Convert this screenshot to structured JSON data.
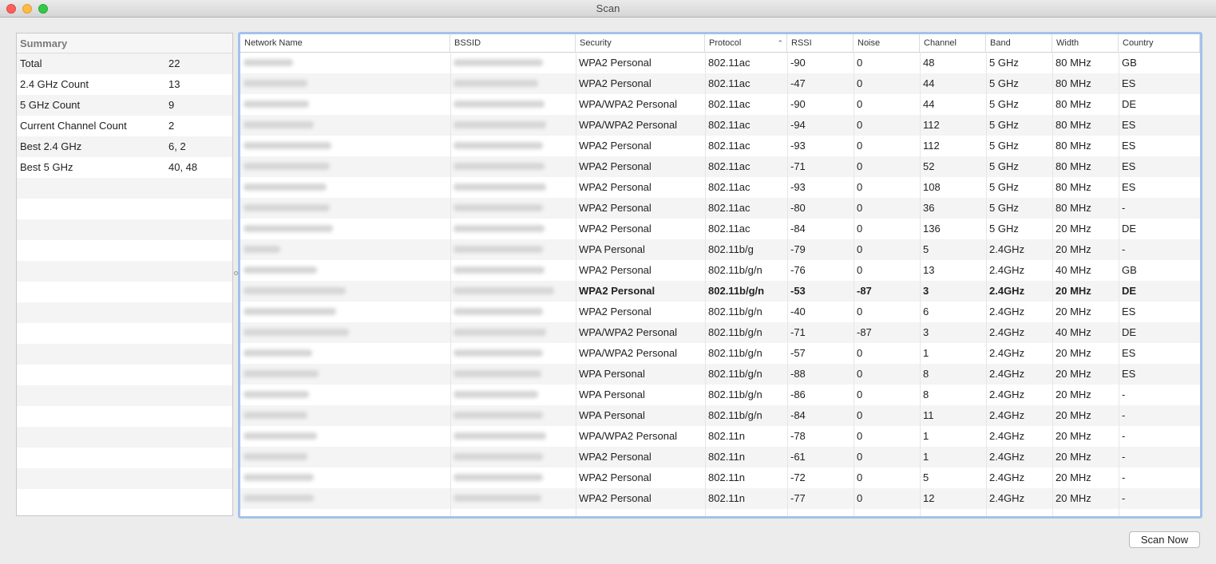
{
  "window": {
    "title": "Scan"
  },
  "summary": {
    "header": "Summary",
    "rows": [
      {
        "label": "Total",
        "value": "22"
      },
      {
        "label": "2.4 GHz Count",
        "value": "13"
      },
      {
        "label": "5 GHz Count",
        "value": "9"
      },
      {
        "label": "Current Channel Count",
        "value": "2"
      },
      {
        "label": "Best 2.4 GHz",
        "value": "6, 2"
      },
      {
        "label": "Best 5 GHz",
        "value": "40, 48"
      }
    ]
  },
  "table": {
    "columns": [
      "Network Name",
      "BSSID",
      "Security",
      "Protocol",
      "RSSI",
      "Noise",
      "Channel",
      "Band",
      "Width",
      "Country"
    ],
    "sorted_column": "Protocol",
    "rows": [
      {
        "security": "WPA2 Personal",
        "protocol": "802.11ac",
        "rssi": "-90",
        "noise": "0",
        "channel": "48",
        "band": "5 GHz",
        "width": "80 MHz",
        "country": "GB"
      },
      {
        "security": "WPA2 Personal",
        "protocol": "802.11ac",
        "rssi": "-47",
        "noise": "0",
        "channel": "44",
        "band": "5 GHz",
        "width": "80 MHz",
        "country": "ES"
      },
      {
        "security": "WPA/WPA2 Personal",
        "protocol": "802.11ac",
        "rssi": "-90",
        "noise": "0",
        "channel": "44",
        "band": "5 GHz",
        "width": "80 MHz",
        "country": "DE"
      },
      {
        "security": "WPA/WPA2 Personal",
        "protocol": "802.11ac",
        "rssi": "-94",
        "noise": "0",
        "channel": "112",
        "band": "5 GHz",
        "width": "80 MHz",
        "country": "ES"
      },
      {
        "security": "WPA2 Personal",
        "protocol": "802.11ac",
        "rssi": "-93",
        "noise": "0",
        "channel": "112",
        "band": "5 GHz",
        "width": "80 MHz",
        "country": "ES"
      },
      {
        "security": "WPA2 Personal",
        "protocol": "802.11ac",
        "rssi": "-71",
        "noise": "0",
        "channel": "52",
        "band": "5 GHz",
        "width": "80 MHz",
        "country": "ES"
      },
      {
        "security": "WPA2 Personal",
        "protocol": "802.11ac",
        "rssi": "-93",
        "noise": "0",
        "channel": "108",
        "band": "5 GHz",
        "width": "80 MHz",
        "country": "ES"
      },
      {
        "security": "WPA2 Personal",
        "protocol": "802.11ac",
        "rssi": "-80",
        "noise": "0",
        "channel": "36",
        "band": "5 GHz",
        "width": "80 MHz",
        "country": "-"
      },
      {
        "security": "WPA2 Personal",
        "protocol": "802.11ac",
        "rssi": "-84",
        "noise": "0",
        "channel": "136",
        "band": "5 GHz",
        "width": "20 MHz",
        "country": "DE"
      },
      {
        "security": "WPA Personal",
        "protocol": "802.11b/g",
        "rssi": "-79",
        "noise": "0",
        "channel": "5",
        "band": "2.4GHz",
        "width": "20 MHz",
        "country": "-"
      },
      {
        "security": "WPA2 Personal",
        "protocol": "802.11b/g/n",
        "rssi": "-76",
        "noise": "0",
        "channel": "13",
        "band": "2.4GHz",
        "width": "40 MHz",
        "country": "GB"
      },
      {
        "security": "WPA2 Personal",
        "protocol": "802.11b/g/n",
        "rssi": "-53",
        "noise": "-87",
        "channel": "3",
        "band": "2.4GHz",
        "width": "20 MHz",
        "country": "DE",
        "current": true
      },
      {
        "security": "WPA2 Personal",
        "protocol": "802.11b/g/n",
        "rssi": "-40",
        "noise": "0",
        "channel": "6",
        "band": "2.4GHz",
        "width": "20 MHz",
        "country": "ES"
      },
      {
        "security": "WPA/WPA2 Personal",
        "protocol": "802.11b/g/n",
        "rssi": "-71",
        "noise": "-87",
        "channel": "3",
        "band": "2.4GHz",
        "width": "40 MHz",
        "country": "DE"
      },
      {
        "security": "WPA/WPA2 Personal",
        "protocol": "802.11b/g/n",
        "rssi": "-57",
        "noise": "0",
        "channel": "1",
        "band": "2.4GHz",
        "width": "20 MHz",
        "country": "ES"
      },
      {
        "security": "WPA Personal",
        "protocol": "802.11b/g/n",
        "rssi": "-88",
        "noise": "0",
        "channel": "8",
        "band": "2.4GHz",
        "width": "20 MHz",
        "country": "ES"
      },
      {
        "security": "WPA Personal",
        "protocol": "802.11b/g/n",
        "rssi": "-86",
        "noise": "0",
        "channel": "8",
        "band": "2.4GHz",
        "width": "20 MHz",
        "country": "-"
      },
      {
        "security": "WPA Personal",
        "protocol": "802.11b/g/n",
        "rssi": "-84",
        "noise": "0",
        "channel": "11",
        "band": "2.4GHz",
        "width": "20 MHz",
        "country": "-"
      },
      {
        "security": "WPA/WPA2 Personal",
        "protocol": "802.11n",
        "rssi": "-78",
        "noise": "0",
        "channel": "1",
        "band": "2.4GHz",
        "width": "20 MHz",
        "country": "-"
      },
      {
        "security": "WPA2 Personal",
        "protocol": "802.11n",
        "rssi": "-61",
        "noise": "0",
        "channel": "1",
        "band": "2.4GHz",
        "width": "20 MHz",
        "country": "-"
      },
      {
        "security": "WPA2 Personal",
        "protocol": "802.11n",
        "rssi": "-72",
        "noise": "0",
        "channel": "5",
        "band": "2.4GHz",
        "width": "20 MHz",
        "country": "-"
      },
      {
        "security": "WPA2 Personal",
        "protocol": "802.11n",
        "rssi": "-77",
        "noise": "0",
        "channel": "12",
        "band": "2.4GHz",
        "width": "20 MHz",
        "country": "-"
      }
    ]
  },
  "actions": {
    "scan_now_label": "Scan Now"
  }
}
